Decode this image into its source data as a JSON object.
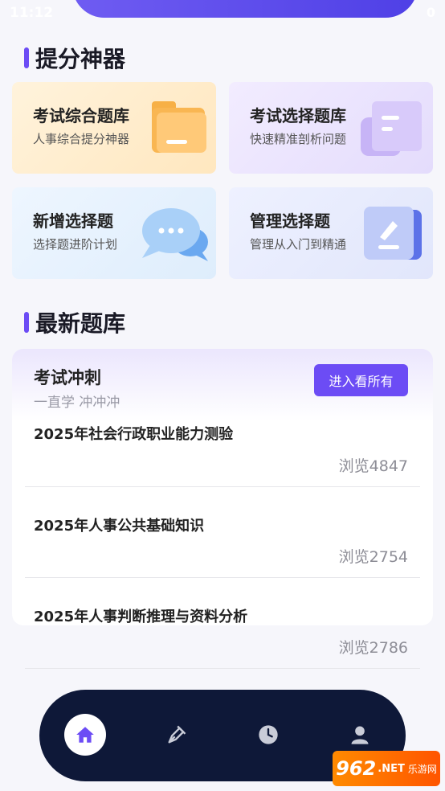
{
  "status_bar": {
    "time": "11:12",
    "right": "0"
  },
  "sections": {
    "tools_title": "提分神器",
    "latest_title": "最新题库"
  },
  "tools": [
    {
      "title": "考试综合题库",
      "subtitle": "人事综合提分神器",
      "icon": "folder-icon"
    },
    {
      "title": "考试选择题库",
      "subtitle": "快速精准剖析问题",
      "icon": "document-icon"
    },
    {
      "title": "新增选择题",
      "subtitle": "选择题进阶计划",
      "icon": "chat-bubble-icon"
    },
    {
      "title": "管理选择题",
      "subtitle": "管理从入门到精通",
      "icon": "edit-icon"
    }
  ],
  "panel": {
    "title": "考试冲刺",
    "subtitle": "一直学 冲冲冲",
    "view_all_label": "进入看所有"
  },
  "question_banks": [
    {
      "title": "2025年社会行政职业能力测验",
      "views": "浏览4847"
    },
    {
      "title": "2025年人事公共基础知识",
      "views": "浏览2754"
    },
    {
      "title": "2025年人事判断推理与资料分析",
      "views": "浏览2786"
    }
  ],
  "bottom_nav": [
    {
      "name": "home",
      "icon": "home-icon",
      "active": true
    },
    {
      "name": "practice",
      "icon": "pen-icon",
      "active": false
    },
    {
      "name": "history",
      "icon": "clock-icon",
      "active": false
    },
    {
      "name": "profile",
      "icon": "user-icon",
      "active": false
    }
  ],
  "watermark": {
    "main": "962",
    "suffix": ".NET",
    "sub": "乐游网"
  },
  "colors": {
    "accent": "#6c4cf5",
    "nav_bg": "#0e1838"
  }
}
